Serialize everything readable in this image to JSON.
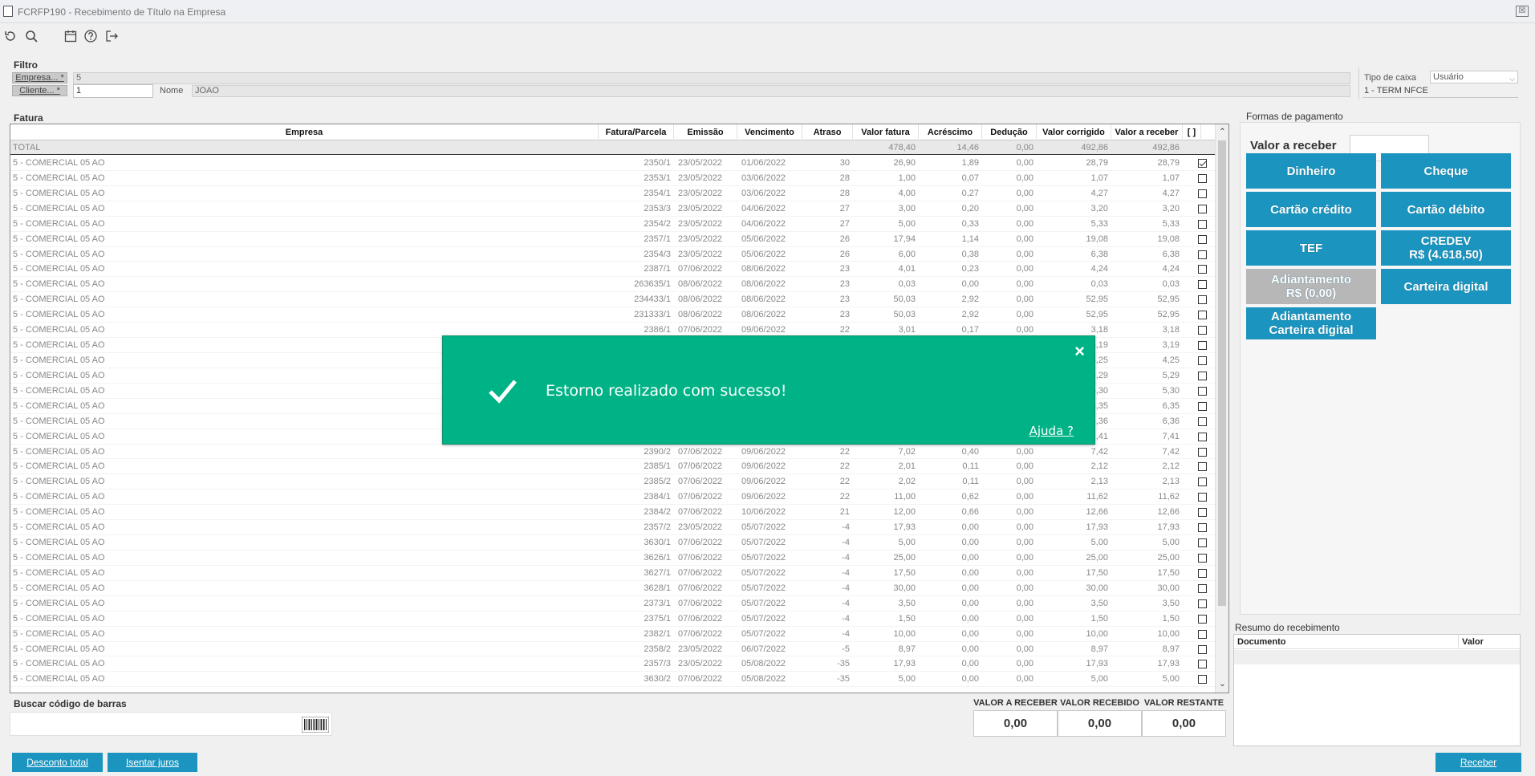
{
  "window": {
    "title": "FCRFP190 - Recebimento de Título na Empresa",
    "close_label": "☒"
  },
  "toolbar": {
    "icons": [
      "refresh-icon",
      "search-icon",
      "calendar-icon",
      "help-icon",
      "exit-icon"
    ]
  },
  "filter": {
    "title": "Filtro",
    "empresa_label": "Empresa... *",
    "empresa_value": "5",
    "cliente_label": "Cliente... *",
    "cliente_value": "1",
    "nome_label": "Nome",
    "nome_value": "JOAO",
    "tipo_caixa_label": "Tipo de caixa",
    "tipo_caixa_value": "Usuário",
    "terminal_value": "1 - TERM NFCE"
  },
  "fatura": {
    "title": "Fatura",
    "columns": [
      "Empresa",
      "Fatura/Parcela",
      "Emissão",
      "Vencimento",
      "Atraso",
      "Valor fatura",
      "Acréscimo",
      "Dedução",
      "Valor corrigido",
      "Valor a receber",
      "[ ]"
    ],
    "total": {
      "label": "TOTAL",
      "valor_fatura": "478,40",
      "acrescimo": "14,46",
      "deducao": "0,00",
      "valor_corrigido": "492,86",
      "valor_receber": "492,86"
    },
    "rows": [
      [
        "5 - COMERCIAL 05 AO",
        "2350/1",
        "23/05/2022",
        "01/06/2022",
        "30",
        "26,90",
        "1,89",
        "0,00",
        "28,79",
        "28,79",
        true
      ],
      [
        "5 - COMERCIAL 05 AO",
        "2353/1",
        "23/05/2022",
        "03/06/2022",
        "28",
        "1,00",
        "0,07",
        "0,00",
        "1,07",
        "1,07",
        false
      ],
      [
        "5 - COMERCIAL 05 AO",
        "2354/1",
        "23/05/2022",
        "03/06/2022",
        "28",
        "4,00",
        "0,27",
        "0,00",
        "4,27",
        "4,27",
        false
      ],
      [
        "5 - COMERCIAL 05 AO",
        "2353/3",
        "23/05/2022",
        "04/06/2022",
        "27",
        "3,00",
        "0,20",
        "0,00",
        "3,20",
        "3,20",
        false
      ],
      [
        "5 - COMERCIAL 05 AO",
        "2354/2",
        "23/05/2022",
        "04/06/2022",
        "27",
        "5,00",
        "0,33",
        "0,00",
        "5,33",
        "5,33",
        false
      ],
      [
        "5 - COMERCIAL 05 AO",
        "2357/1",
        "23/05/2022",
        "05/06/2022",
        "26",
        "17,94",
        "1,14",
        "0,00",
        "19,08",
        "19,08",
        false
      ],
      [
        "5 - COMERCIAL 05 AO",
        "2354/3",
        "23/05/2022",
        "05/06/2022",
        "26",
        "6,00",
        "0,38",
        "0,00",
        "6,38",
        "6,38",
        false
      ],
      [
        "5 - COMERCIAL 05 AO",
        "2387/1",
        "07/06/2022",
        "08/06/2022",
        "23",
        "4,01",
        "0,23",
        "0,00",
        "4,24",
        "4,24",
        false
      ],
      [
        "5 - COMERCIAL 05 AO",
        "263635/1",
        "08/06/2022",
        "08/06/2022",
        "23",
        "0,03",
        "0,00",
        "0,00",
        "0,03",
        "0,03",
        false
      ],
      [
        "5 - COMERCIAL 05 AO",
        "234433/1",
        "08/06/2022",
        "08/06/2022",
        "23",
        "50,03",
        "2,92",
        "0,00",
        "52,95",
        "52,95",
        false
      ],
      [
        "5 - COMERCIAL 05 AO",
        "231333/1",
        "08/06/2022",
        "08/06/2022",
        "23",
        "50,03",
        "2,92",
        "0,00",
        "52,95",
        "52,95",
        false
      ],
      [
        "5 - COMERCIAL 05 AO",
        "2386/1",
        "07/06/2022",
        "09/06/2022",
        "22",
        "3,01",
        "0,17",
        "0,00",
        "3,18",
        "3,18",
        false
      ],
      [
        "5 - COMERCIAL 05 AO",
        "",
        "",
        "",
        "",
        "",
        "",
        "",
        "3,19",
        "3,19",
        false
      ],
      [
        "5 - COMERCIAL 05 AO",
        "",
        "",
        "",
        "",
        "",
        "",
        "",
        "4,25",
        "4,25",
        false
      ],
      [
        "5 - COMERCIAL 05 AO",
        "",
        "",
        "",
        "",
        "",
        "",
        "",
        "5,29",
        "5,29",
        false
      ],
      [
        "5 - COMERCIAL 05 AO",
        "",
        "",
        "",
        "",
        "",
        "",
        "",
        "5,30",
        "5,30",
        false
      ],
      [
        "5 - COMERCIAL 05 AO",
        "",
        "",
        "",
        "",
        "",
        "",
        "",
        "6,35",
        "6,35",
        false
      ],
      [
        "5 - COMERCIAL 05 AO",
        "",
        "",
        "",
        "",
        "",
        "",
        "",
        "6,36",
        "6,36",
        false
      ],
      [
        "5 - COMERCIAL 05 AO",
        "",
        "",
        "",
        "",
        "",
        "",
        "",
        "7,41",
        "7,41",
        false
      ],
      [
        "5 - COMERCIAL 05 AO",
        "2390/2",
        "07/06/2022",
        "09/06/2022",
        "22",
        "7,02",
        "0,40",
        "0,00",
        "7,42",
        "7,42",
        false
      ],
      [
        "5 - COMERCIAL 05 AO",
        "2385/1",
        "07/06/2022",
        "09/06/2022",
        "22",
        "2,01",
        "0,11",
        "0,00",
        "2,12",
        "2,12",
        false
      ],
      [
        "5 - COMERCIAL 05 AO",
        "2385/2",
        "07/06/2022",
        "09/06/2022",
        "22",
        "2,02",
        "0,11",
        "0,00",
        "2,13",
        "2,13",
        false
      ],
      [
        "5 - COMERCIAL 05 AO",
        "2384/1",
        "07/06/2022",
        "09/06/2022",
        "22",
        "11,00",
        "0,62",
        "0,00",
        "11,62",
        "11,62",
        false
      ],
      [
        "5 - COMERCIAL 05 AO",
        "2384/2",
        "07/06/2022",
        "10/06/2022",
        "21",
        "12,00",
        "0,66",
        "0,00",
        "12,66",
        "12,66",
        false
      ],
      [
        "5 - COMERCIAL 05 AO",
        "2357/2",
        "23/05/2022",
        "05/07/2022",
        "-4",
        "17,93",
        "0,00",
        "0,00",
        "17,93",
        "17,93",
        false
      ],
      [
        "5 - COMERCIAL 05 AO",
        "3630/1",
        "07/06/2022",
        "05/07/2022",
        "-4",
        "5,00",
        "0,00",
        "0,00",
        "5,00",
        "5,00",
        false
      ],
      [
        "5 - COMERCIAL 05 AO",
        "3626/1",
        "07/06/2022",
        "05/07/2022",
        "-4",
        "25,00",
        "0,00",
        "0,00",
        "25,00",
        "25,00",
        false
      ],
      [
        "5 - COMERCIAL 05 AO",
        "3627/1",
        "07/06/2022",
        "05/07/2022",
        "-4",
        "17,50",
        "0,00",
        "0,00",
        "17,50",
        "17,50",
        false
      ],
      [
        "5 - COMERCIAL 05 AO",
        "3628/1",
        "07/06/2022",
        "05/07/2022",
        "-4",
        "30,00",
        "0,00",
        "0,00",
        "30,00",
        "30,00",
        false
      ],
      [
        "5 - COMERCIAL 05 AO",
        "2373/1",
        "07/06/2022",
        "05/07/2022",
        "-4",
        "3,50",
        "0,00",
        "0,00",
        "3,50",
        "3,50",
        false
      ],
      [
        "5 - COMERCIAL 05 AO",
        "2375/1",
        "07/06/2022",
        "05/07/2022",
        "-4",
        "1,50",
        "0,00",
        "0,00",
        "1,50",
        "1,50",
        false
      ],
      [
        "5 - COMERCIAL 05 AO",
        "2382/1",
        "07/06/2022",
        "05/07/2022",
        "-4",
        "10,00",
        "0,00",
        "0,00",
        "10,00",
        "10,00",
        false
      ],
      [
        "5 - COMERCIAL 05 AO",
        "2358/2",
        "23/05/2022",
        "06/07/2022",
        "-5",
        "8,97",
        "0,00",
        "0,00",
        "8,97",
        "8,97",
        false
      ],
      [
        "5 - COMERCIAL 05 AO",
        "2357/3",
        "23/05/2022",
        "05/08/2022",
        "-35",
        "17,93",
        "0,00",
        "0,00",
        "17,93",
        "17,93",
        false
      ],
      [
        "5 - COMERCIAL 05 AO",
        "3630/2",
        "07/06/2022",
        "05/08/2022",
        "-35",
        "5,00",
        "0,00",
        "0,00",
        "5,00",
        "5,00",
        false
      ]
    ]
  },
  "payment": {
    "title": "Formas de pagamento",
    "valor_label": "Valor a receber",
    "buttons": [
      {
        "l1": "Dinheiro",
        "l2": "",
        "color": "#1b95bf"
      },
      {
        "l1": "Cheque",
        "l2": "",
        "color": "#1b95bf"
      },
      {
        "l1": "Cartão crédito",
        "l2": "",
        "color": "#1b95bf"
      },
      {
        "l1": "Cartão débito",
        "l2": "",
        "color": "#1b95bf"
      },
      {
        "l1": "TEF",
        "l2": "",
        "color": "#1b95bf"
      },
      {
        "l1": "CREDEV",
        "l2": "R$ (4.618,50)",
        "color": "#1b95bf"
      },
      {
        "l1": "Adiantamento",
        "l2": "R$ (0,00)",
        "color": "#b7b7b7"
      },
      {
        "l1": "Carteira digital",
        "l2": "",
        "color": "#1b95bf"
      },
      {
        "l1": "Adiantamento",
        "l2": "Carteira digital",
        "color": "#1b95bf"
      }
    ]
  },
  "resumo": {
    "title": "Resumo do recebimento",
    "col_documento": "Documento",
    "col_valor": "Valor"
  },
  "barcode": {
    "label": "Buscar código de barras"
  },
  "totals": {
    "valor_receber_label": "VALOR A RECEBER",
    "valor_receber": "0,00",
    "valor_recebido_label": "VALOR RECEBIDO",
    "valor_recebido": "0,00",
    "valor_restante_label": "VALOR RESTANTE",
    "valor_restante": "0,00"
  },
  "bottom": {
    "desconto_label": "Desconto total",
    "isentar_label": "Isentar juros",
    "receber_label": "Receber"
  },
  "toast": {
    "message": "Estorno realizado com sucesso!",
    "help_label": "Ajuda ?",
    "close_label": "×",
    "bg_color": "#00b386"
  }
}
